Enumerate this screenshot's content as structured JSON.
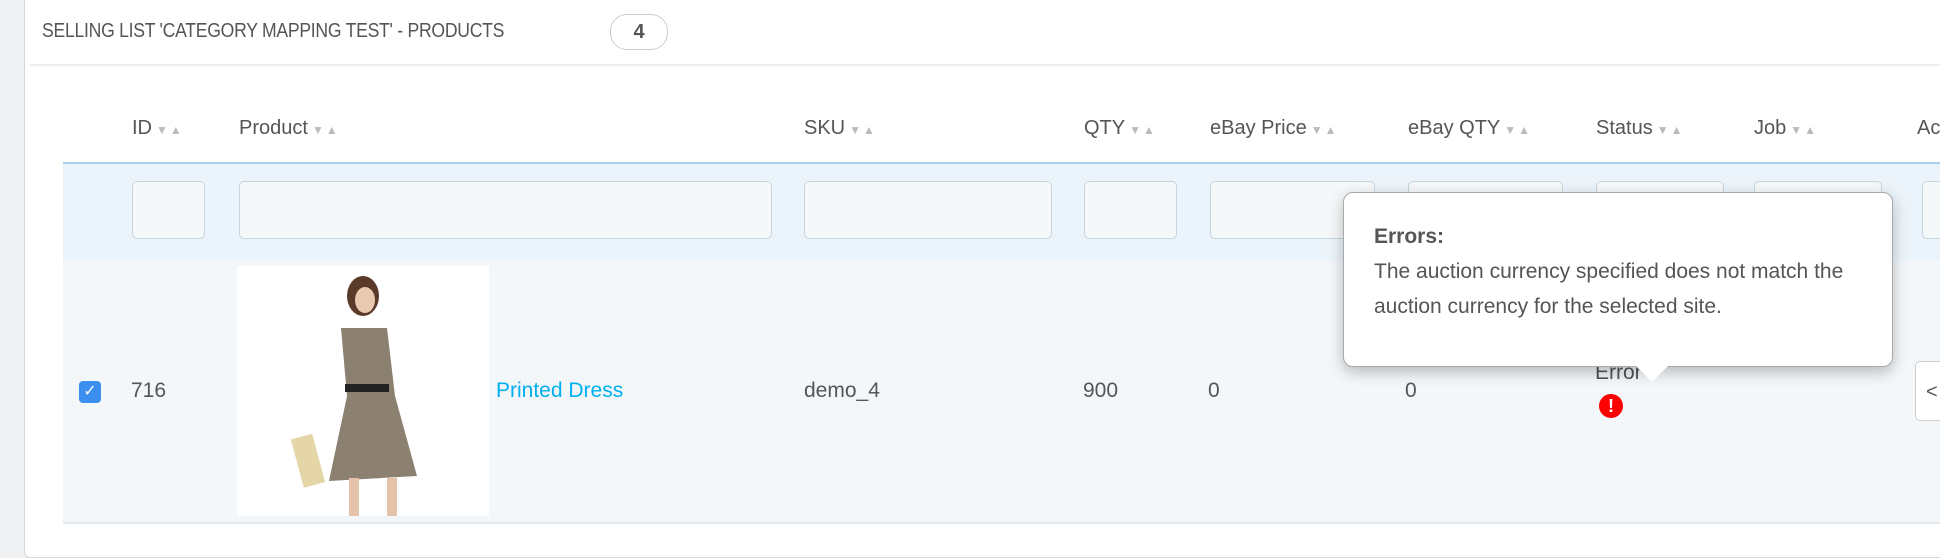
{
  "panel": {
    "title": "SELLING LIST 'CATEGORY MAPPING TEST' - PRODUCTS",
    "count": "4"
  },
  "columns": [
    "ID",
    "Product",
    "SKU",
    "QTY",
    "eBay Price",
    "eBay QTY",
    "Status",
    "Job",
    "Ac"
  ],
  "sort_glyph": "▼▲",
  "rows": [
    {
      "checked": true,
      "id": "716",
      "product": "Printed Dress",
      "sku": "demo_4",
      "qty": "900",
      "ebay_price": "0",
      "ebay_qty": "0",
      "status": "Error"
    }
  ],
  "tooltip": {
    "title": "Errors:",
    "message": "The auction currency specified does not match the auction currency for the selected site."
  },
  "colors": {
    "link": "#00aff0",
    "checkbox": "#3b8fef",
    "error": "#ff0000",
    "filter_bg": "#ecf4fb"
  },
  "icons": {
    "checkbox": "check-icon",
    "status": "exclamation-circle-icon",
    "action": "eye-icon"
  }
}
